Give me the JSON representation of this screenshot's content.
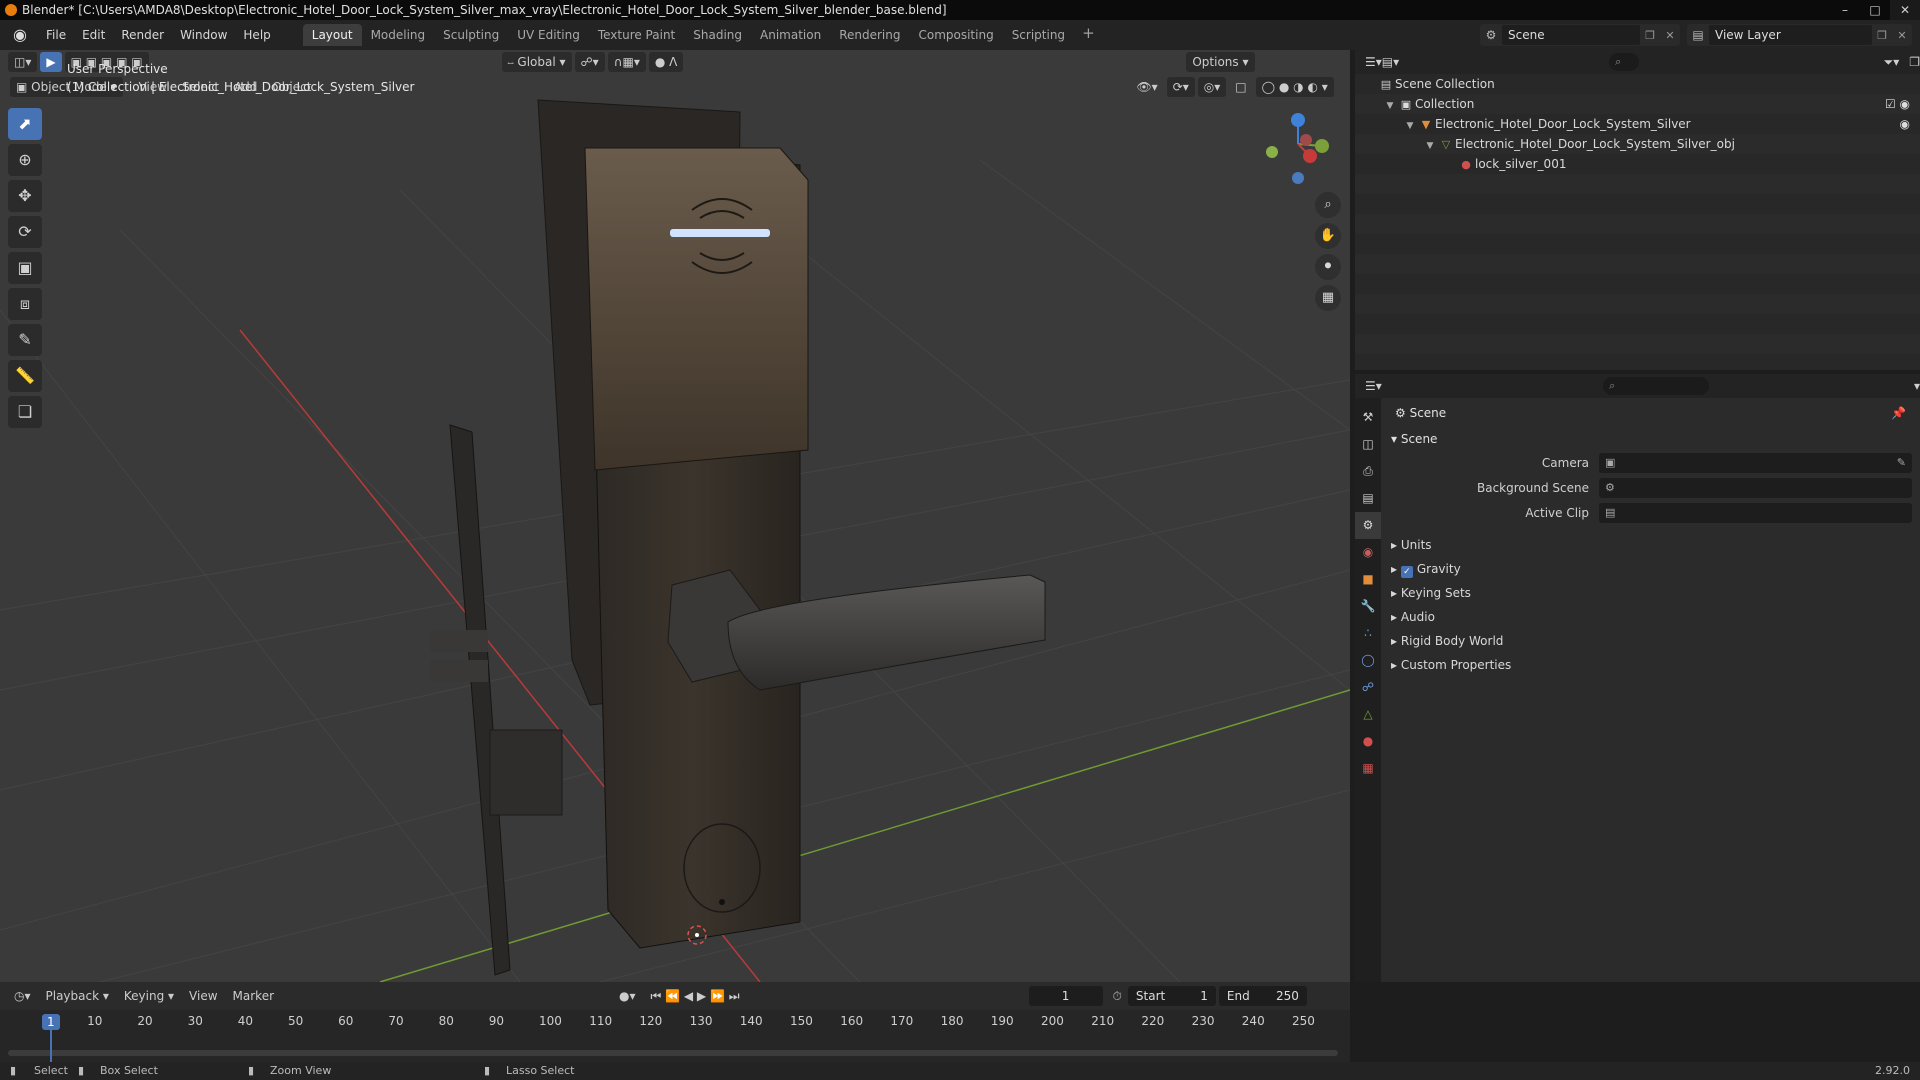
{
  "window": {
    "title": "Blender* [C:\\Users\\AMDA8\\Desktop\\Electronic_Hotel_Door_Lock_System_Silver_max_vray\\Electronic_Hotel_Door_Lock_System_Silver_blender_base.blend]",
    "controls": [
      "–",
      "□",
      "✕"
    ]
  },
  "menu": [
    "File",
    "Edit",
    "Render",
    "Window",
    "Help"
  ],
  "workspaces": [
    "Layout",
    "Modeling",
    "Sculpting",
    "UV Editing",
    "Texture Paint",
    "Shading",
    "Animation",
    "Rendering",
    "Compositing",
    "Scripting"
  ],
  "workspace_add": "+",
  "scene_selector": {
    "name": "Scene"
  },
  "view_layer": {
    "name": "View Layer"
  },
  "viewport_header": {
    "orientation": "Global",
    "options": "Options",
    "mode": "Object Mode",
    "menus": [
      "View",
      "Select",
      "Add",
      "Object"
    ]
  },
  "viewport_info": {
    "line1": "User Perspective",
    "line2": "(1) Collection | Electronic_Hotel_Door_Lock_System_Silver"
  },
  "outliner": {
    "rows": [
      {
        "label": "Scene Collection",
        "indent": 0,
        "icon": "scene-collection-icon",
        "twisty": ""
      },
      {
        "label": "Collection",
        "indent": 1,
        "icon": "collection-icon",
        "twisty": "▼"
      },
      {
        "label": "Electronic_Hotel_Door_Lock_System_Silver",
        "indent": 2,
        "icon": "object-icon",
        "twisty": "▼"
      },
      {
        "label": "Electronic_Hotel_Door_Lock_System_Silver_obj",
        "indent": 3,
        "icon": "mesh-icon",
        "twisty": "▼"
      },
      {
        "label": "lock_silver_001",
        "indent": 4,
        "icon": "material-icon",
        "twisty": ""
      }
    ]
  },
  "properties": {
    "breadcrumb": "Scene",
    "panel": "Scene",
    "fields": [
      {
        "label": "Camera",
        "value": ""
      },
      {
        "label": "Background Scene",
        "value": ""
      },
      {
        "label": "Active Clip",
        "value": ""
      }
    ],
    "subpanels": [
      "Units",
      "Gravity",
      "Keying Sets",
      "Audio",
      "Rigid Body World",
      "Custom Properties"
    ]
  },
  "timeline": {
    "menus": [
      "Playback",
      "Keying",
      "View",
      "Marker"
    ],
    "current_frame": "1",
    "start_label": "Start",
    "start": "1",
    "end_label": "End",
    "end": "250",
    "ticks": [
      "1",
      "10",
      "20",
      "30",
      "40",
      "50",
      "60",
      "70",
      "80",
      "90",
      "100",
      "110",
      "120",
      "130",
      "140",
      "150",
      "160",
      "170",
      "180",
      "190",
      "200",
      "210",
      "220",
      "230",
      "240",
      "250"
    ]
  },
  "statusbar": {
    "select": "Select",
    "box_select": "Box Select",
    "zoom_view": "Zoom View",
    "lasso_select": "Lasso Select",
    "version": "2.92.0"
  },
  "colors": {
    "accent": "#4772b3",
    "brand": "#e87d0d",
    "x_axis": "#c73a3a",
    "y_axis": "#7ba03a",
    "z_axis": "#3f82d9"
  }
}
